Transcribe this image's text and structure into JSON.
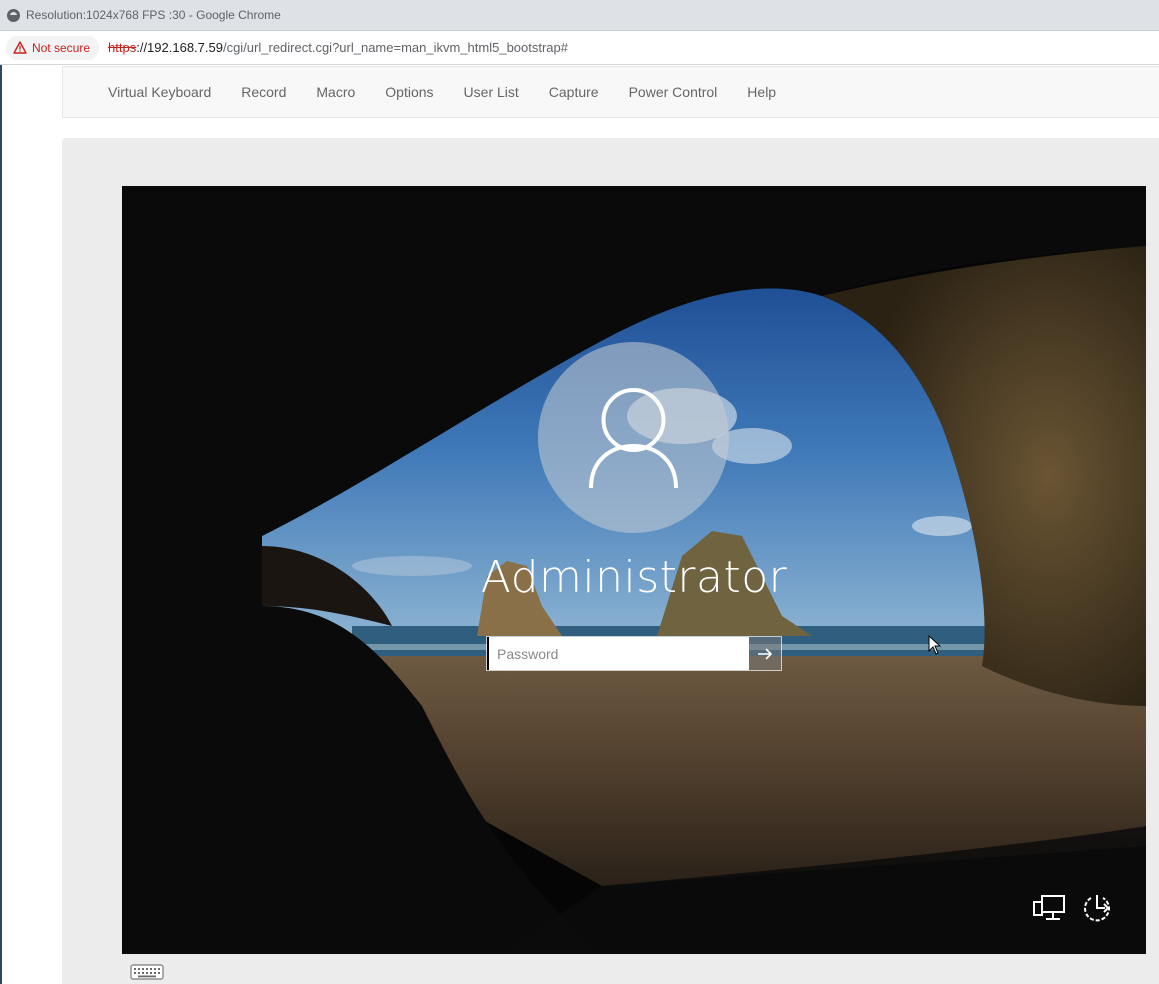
{
  "browser": {
    "window_title": "Resolution:1024x768 FPS :30 - Google Chrome",
    "security_label": "Not secure",
    "url_scheme": "https",
    "url_host": "://192.168.7.59",
    "url_path": "/cgi/url_redirect.cgi?url_name=man_ikvm_html5_bootstrap#"
  },
  "menu": {
    "items": [
      {
        "label": "Virtual Keyboard"
      },
      {
        "label": "Record"
      },
      {
        "label": "Macro"
      },
      {
        "label": "Options"
      },
      {
        "label": "User List"
      },
      {
        "label": "Capture"
      },
      {
        "label": "Power Control"
      },
      {
        "label": "Help"
      }
    ]
  },
  "remote_screen": {
    "username": "Administrator",
    "password_placeholder": "Password",
    "icons": [
      "user-avatar-icon",
      "arrow-right-icon",
      "network-icon",
      "power-icon",
      "mouse-cursor-icon"
    ]
  },
  "footer": {
    "icons": [
      "keyboard-icon"
    ]
  }
}
